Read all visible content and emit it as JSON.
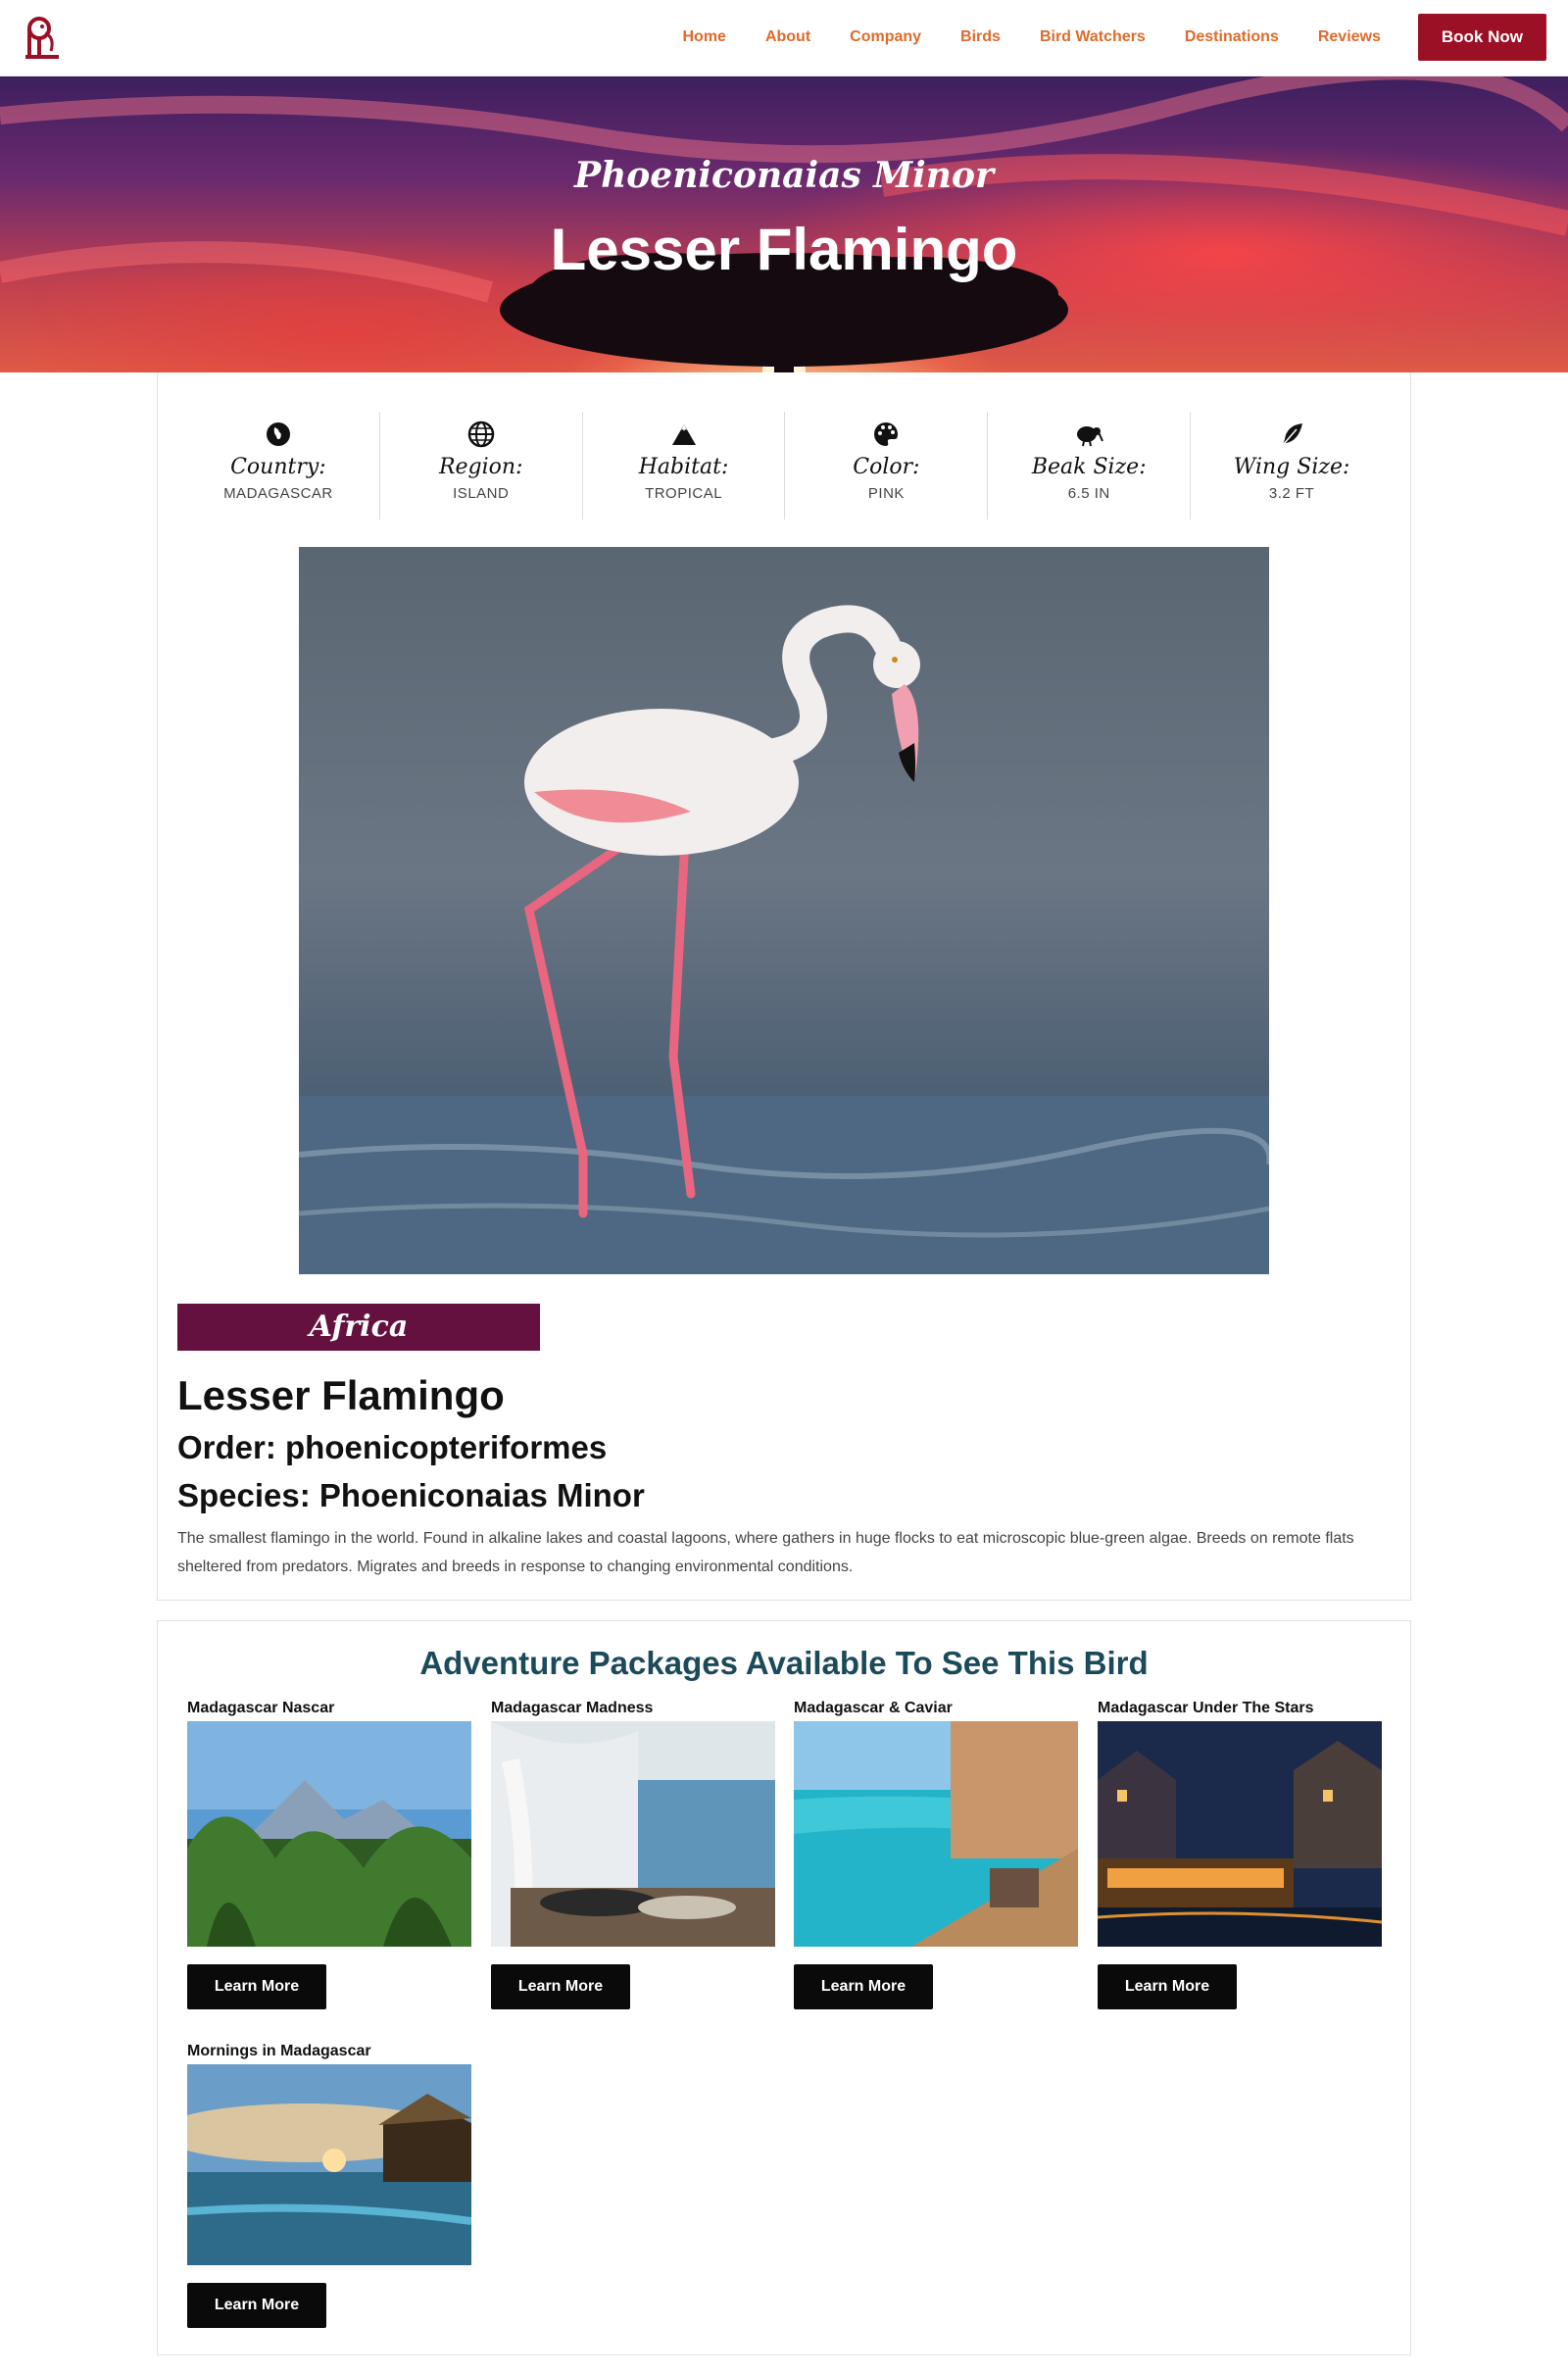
{
  "nav": {
    "items": [
      "Home",
      "About",
      "Company",
      "Birds",
      "Bird Watchers",
      "Destinations",
      "Reviews"
    ],
    "cta": "Book Now"
  },
  "hero": {
    "subtitle": "Phoeniconaias Minor",
    "title": "Lesser Flamingo"
  },
  "facts": [
    {
      "label": "Country:",
      "value": "MADAGASCAR",
      "icon": "globe-africa-icon"
    },
    {
      "label": "Region:",
      "value": "ISLAND",
      "icon": "globe-grid-icon"
    },
    {
      "label": "Habitat:",
      "value": "TROPICAL",
      "icon": "mountain-icon"
    },
    {
      "label": "Color:",
      "value": "PINK",
      "icon": "palette-icon"
    },
    {
      "label": "Beak Size:",
      "value": "6.5 IN",
      "icon": "kiwi-bird-icon"
    },
    {
      "label": "Wing Size:",
      "value": "3.2 FT",
      "icon": "feather-icon"
    }
  ],
  "bird": {
    "region": "Africa",
    "name": "Lesser Flamingo",
    "order": "Order: phoenicopteriformes",
    "species": "Species: Phoeniconaias Minor",
    "description": "The smallest flamingo in the world. Found in alkaline lakes and coastal lagoons, where gathers in huge flocks to eat microscopic blue-green algae. Breeds on remote flats sheltered from predators. Migrates and breeds in response to changing environmental conditions."
  },
  "packages": {
    "heading": "Adventure Packages Available To See This Bird",
    "items": [
      {
        "name": "Madagascar Nascar",
        "button": "Learn More"
      },
      {
        "name": "Madagascar Madness",
        "button": "Learn More"
      },
      {
        "name": "Madagascar & Caviar",
        "button": "Learn More"
      },
      {
        "name": "Madagascar Under The Stars",
        "button": "Learn More"
      },
      {
        "name": "Mornings in Madagascar",
        "button": "Learn More"
      }
    ]
  },
  "colors": {
    "nav_link": "#e06a2a",
    "cta_bg": "#9c1026",
    "region_banner": "#641140",
    "heading_teal": "#1b4a5a"
  }
}
